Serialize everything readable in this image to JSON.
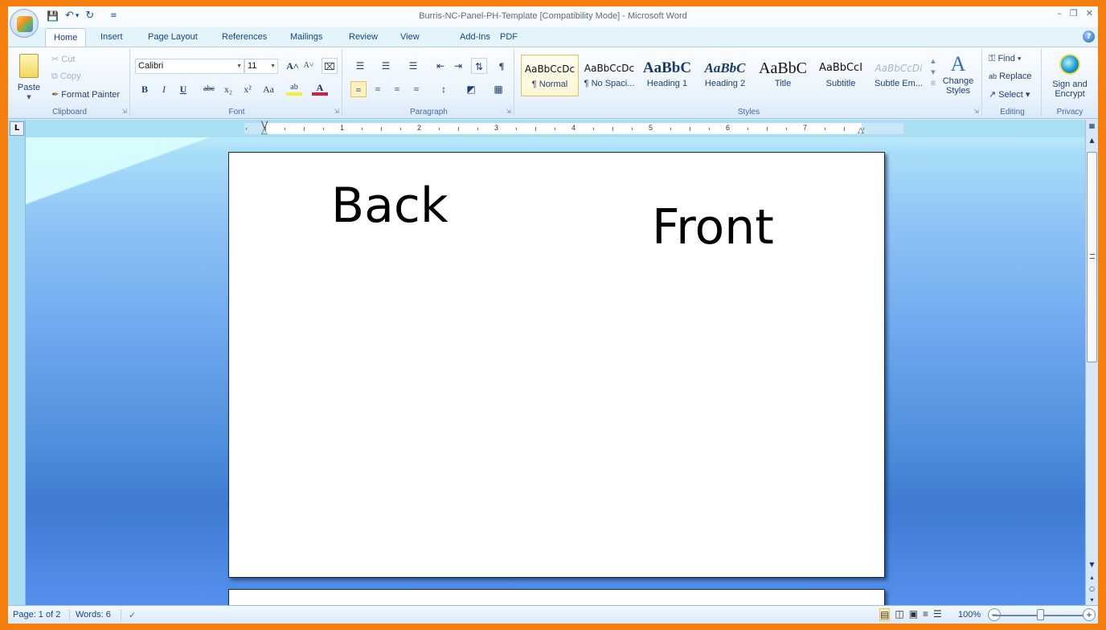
{
  "window": {
    "title": "Burris-NC-Panel-PH-Template [Compatibility Mode] - Microsoft Word",
    "controls": [
      "minimize",
      "restore",
      "close"
    ]
  },
  "quick_access": {
    "save_icon": "💾",
    "undo_icon": "↶",
    "undo_dropdown": "▾",
    "redo_icon": "↻",
    "customize_icon": "≡"
  },
  "tabs": [
    {
      "label": "Home",
      "active": true
    },
    {
      "label": "Insert"
    },
    {
      "label": "Page Layout"
    },
    {
      "label": "References"
    },
    {
      "label": "Mailings"
    },
    {
      "label": "Review"
    },
    {
      "label": "View"
    },
    {
      "label": "Add-Ins"
    },
    {
      "label": "PDF"
    }
  ],
  "help_icon": "?",
  "ribbon": {
    "clipboard": {
      "label": "Clipboard",
      "paste": "Paste",
      "cut": "Cut",
      "copy": "Copy",
      "format_painter": "Format Painter"
    },
    "font": {
      "label": "Font",
      "font_name": "Calibri",
      "font_size": "11",
      "grow": "A˄",
      "shrink": "A˅",
      "clear": "⌧",
      "bold": "B",
      "italic": "I",
      "underline": "U",
      "strikethrough": "abc",
      "subscript": "x₂",
      "superscript": "x²",
      "change_case": "Aa",
      "highlight": "ab",
      "font_color": "A"
    },
    "paragraph": {
      "label": "Paragraph",
      "bullets": "☰",
      "numbering": "☰",
      "multilevel": "☰",
      "decrease_indent": "⇤",
      "increase_indent": "⇥",
      "sort": "⇅",
      "show_marks": "¶",
      "align_left": "≡",
      "center": "≡",
      "align_right": "≡",
      "justify": "≡",
      "line_spacing": "↕",
      "shading": "◩",
      "borders": "▦"
    },
    "styles": {
      "label": "Styles",
      "items": [
        {
          "preview": "AaBbCcDc",
          "name": "¶ Normal",
          "selected": true
        },
        {
          "preview": "AaBbCcDc",
          "name": "¶ No Spaci..."
        },
        {
          "preview": "AaBbC",
          "name": "Heading 1"
        },
        {
          "preview": "AaBbC",
          "name": "Heading 2"
        },
        {
          "preview": "AaBbC",
          "name": "Title"
        },
        {
          "preview": "AaBbCcI",
          "name": "Subtitle"
        },
        {
          "preview": "AaBbCcDi",
          "name": "Subtle Em..."
        }
      ],
      "change_styles": "Change Styles"
    },
    "editing": {
      "label": "Editing",
      "find": "Find",
      "replace": "Replace",
      "select": "Select"
    },
    "privacy": {
      "label": "Privacy",
      "sign_encrypt": "Sign and Encrypt"
    }
  },
  "ruler": {
    "numbers": [
      "1",
      "2",
      "3",
      "4",
      "5",
      "6",
      "7"
    ],
    "tab_selector": "L"
  },
  "document": {
    "texts": [
      "Back",
      "Front"
    ]
  },
  "status_bar": {
    "page": "Page: 1 of 2",
    "words": "Words: 6",
    "proofing_icon": "✓",
    "zoom": "100%",
    "zoom_out": "−",
    "zoom_in": "+"
  }
}
